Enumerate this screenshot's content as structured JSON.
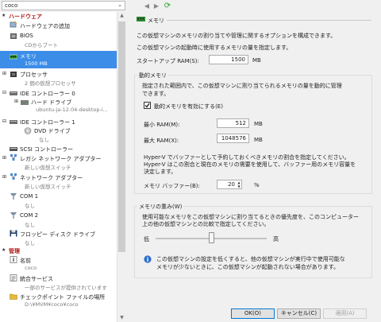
{
  "toolbar": {
    "vm_name": "coco",
    "back": "◀",
    "forward": "▶",
    "refresh": "⟳"
  },
  "sidebar": {
    "hardware_header": "ハードウェア",
    "add_hardware": "ハードウェアの追加",
    "bios": "BIOS",
    "bios_sub": "CDからブート",
    "memory": "メモリ",
    "memory_sub": "1500 MB",
    "processor": "プロセッサ",
    "processor_sub": "2 個の仮想プロセッサ",
    "ide0": "IDE コントローラー 0",
    "hdd": "ハード ドライブ",
    "hdd_sub": "ubuntu-ja-12.04-desktop-i...",
    "ide1": "IDE コントローラー 1",
    "dvd": "DVD ドライブ",
    "dvd_sub": "なし",
    "scsi": "SCSI コントローラー",
    "legacy_nic": "レガシ ネットワーク アダプター",
    "legacy_nic_sub": "新しい仮想スイッチ",
    "nic": "ネットワーク アダプター",
    "nic_sub": "新しい仮想スイッチ",
    "com1": "COM 1",
    "com1_sub": "なし",
    "com2": "COM 2",
    "com2_sub": "なし",
    "floppy": "フロッピー ディスク ドライブ",
    "floppy_sub": "なし",
    "management_header": "管理",
    "name": "名前",
    "name_sub": "coco",
    "integration": "統合サービス",
    "integration_sub": "一部のサービスが提供されています",
    "checkpoint": "チェックポイント ファイルの場所",
    "checkpoint_sub": "D:\\¥MVM¥coco¥coco"
  },
  "memory": {
    "header": "メモリ",
    "desc1": "この仮想マシンのメモリの割り当てや管理に関するオプションを構成できます。",
    "desc2": "この仮想マシンの起動時に使用するメモリの量を指定します。",
    "startup_label": "スタートアップ RAM(S):",
    "startup_value": "1500",
    "unit_mb": "MB",
    "dynamic_title": "動的メモリ",
    "dynamic_desc1": "指定された範囲内で、この仮想マシンに割り当てられるメモリの量を動的に管理",
    "dynamic_desc2": "できます。",
    "dynamic_checkbox": "動的メモリを有効にする(E)",
    "min_label": "最小 RAM(M):",
    "min_value": "512",
    "max_label": "最大 RAM(X):",
    "max_value": "1048576",
    "buffer_desc1": "Hyper-V でバッファーとして予約しておくべきメモリの割合を指定してください。",
    "buffer_desc2": "Hyper-V はこの割合と現在のメモリの需要を使用して、バッファー用のメモリ容量を",
    "buffer_desc3": "決定します。",
    "buffer_label": "メモリ バッファー(B):",
    "buffer_value": "20",
    "percent": "%",
    "weight_title": "メモリの重み(W)",
    "weight_desc1": "使用可能なメモリをこの仮想マシンに割り当てるときの優先度を、このコンピューター",
    "weight_desc2": "上の他の仮想マシンとの比較で指定してください。",
    "low": "低",
    "high": "高",
    "weight_fraction": 0.5,
    "info1": "この仮想マシンの設定を低くすると、他の仮想マシンが実行中で使用可能な",
    "info2": "メモリが少ないときに、この仮想マシンが起動されない場合があります。"
  },
  "buttons": {
    "ok": "OK(O)",
    "cancel": "キャンセル(C)",
    "apply": "適用(A)"
  }
}
